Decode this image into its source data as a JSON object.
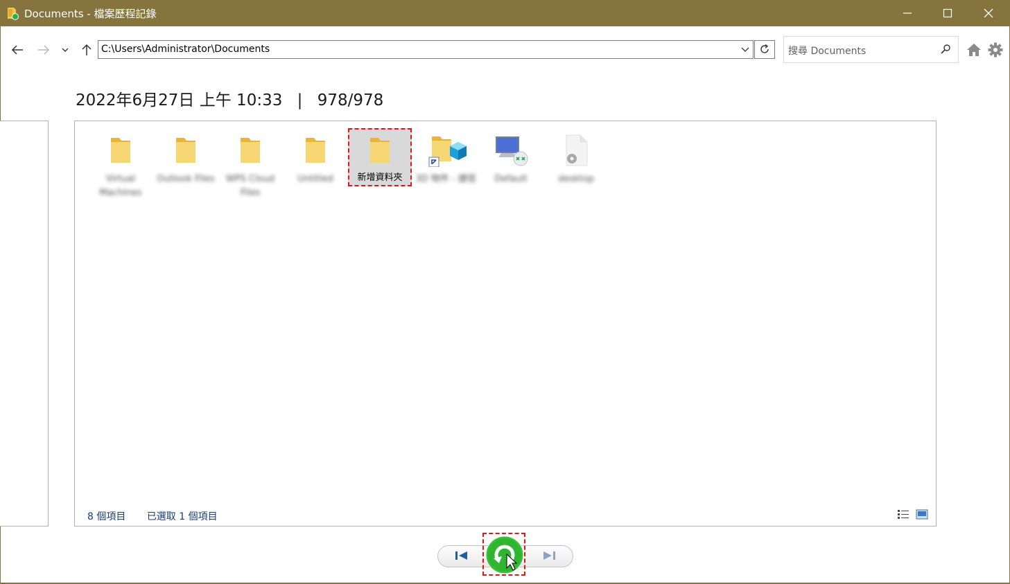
{
  "window": {
    "title": "Documents - 檔案歷程記錄",
    "accent_color": "#86743f",
    "buttons": [
      "minimize-icon",
      "maximize-icon",
      "close-icon"
    ]
  },
  "toolbar": {
    "address": "C:\\Users\\Administrator\\Documents",
    "search_placeholder": "搜尋 Documents",
    "icons": [
      "back-arrow-icon",
      "forward-arrow-icon",
      "recent-dropdown-icon",
      "up-arrow-icon",
      "refresh-icon",
      "search-icon",
      "home-icon",
      "gear-icon"
    ]
  },
  "header": {
    "date": "2022年6月27日 上午 10:33",
    "separator": "|",
    "version": "978/978"
  },
  "items": [
    {
      "label": "Virtual Machines",
      "icon": "folder-icon"
    },
    {
      "label": "Outlook Files",
      "icon": "folder-icon"
    },
    {
      "label": "WPS Cloud Files",
      "icon": "folder-icon"
    },
    {
      "label": "Untitled",
      "icon": "folder-icon"
    },
    {
      "label": "新增資料夾",
      "icon": "folder-icon",
      "selected": true
    },
    {
      "label": "3D 物件 - 捷徑",
      "icon": "3d-objects-shortcut-icon"
    },
    {
      "label": "Default",
      "icon": "remote-desktop-icon"
    },
    {
      "label": "desktop",
      "icon": "settings-file-icon"
    }
  ],
  "status": {
    "count": "8 個項目",
    "selected": "已選取 1 個項目"
  },
  "controls": {
    "icons": [
      "previous-version-icon",
      "restore-icon",
      "next-version-icon"
    ],
    "restore_color": "#2fbf2f"
  }
}
